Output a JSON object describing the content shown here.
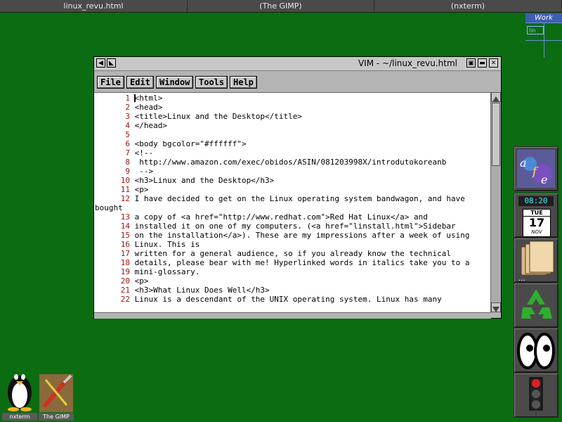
{
  "taskbar": {
    "tasks": [
      {
        "label": "linux_revu.html"
      },
      {
        "label": "(The GIMP)"
      },
      {
        "label": "(nxterm)"
      }
    ]
  },
  "pager": {
    "workspace_name": "Work",
    "window_label": "lin"
  },
  "vim_window": {
    "title": "VIM - ~/linux_revu.html",
    "menus": [
      "File",
      "Edit",
      "Window",
      "Tools",
      "Help"
    ],
    "lines": [
      {
        "num": "1",
        "text": "<html>"
      },
      {
        "num": "2",
        "text": "<head>"
      },
      {
        "num": "3",
        "text": "<title>Linux and the Desktop</title>"
      },
      {
        "num": "4",
        "text": "</head>"
      },
      {
        "num": "5",
        "text": ""
      },
      {
        "num": "6",
        "text": "<body bgcolor=\"#ffffff\">"
      },
      {
        "num": "7",
        "text": "<!--"
      },
      {
        "num": "8",
        "text": " http://www.amazon.com/exec/obidos/ASIN/081203998X/introdutokoreanb"
      },
      {
        "num": "9",
        "text": " -->"
      },
      {
        "num": "10",
        "text": "<h3>Linux and the Desktop</h3>"
      },
      {
        "num": "11",
        "text": "<p>"
      },
      {
        "num": "12",
        "text": "I have decided to get on the Linux operating system bandwagon, and have",
        "wrap": "bought"
      },
      {
        "num": "13",
        "text": "a copy of <a href=\"http://www.redhat.com\">Red Hat Linux</a> and"
      },
      {
        "num": "14",
        "text": "installed it on one of my computers. (<a href=\"linstall.html\">Sidebar"
      },
      {
        "num": "15",
        "text": "on the installation</a>). These are my impressions after a week of using",
        "wrap2": "Linux. This is"
      },
      {
        "num": "17",
        "text": "written for a general audience, so if you already know the technical"
      },
      {
        "num": "18",
        "text": "details, please bear with me! Hyperlinked words in italics take you to a"
      },
      {
        "num": "19",
        "text": "mini-glossary."
      },
      {
        "num": "20",
        "text": "<p>"
      },
      {
        "num": "21",
        "text": "<h3>What Linux Does Well</h3>"
      },
      {
        "num": "22",
        "text": "Linux is a descendant of the UNIX operating system. Linux has many"
      }
    ],
    "line16_num": "16"
  },
  "dock": {
    "clock": "08:20",
    "cal_day": "TUE",
    "cal_date": "17",
    "cal_month": "NOV"
  },
  "desktop_icons": [
    {
      "label": "nxterm"
    },
    {
      "label": "The GIMP"
    }
  ]
}
